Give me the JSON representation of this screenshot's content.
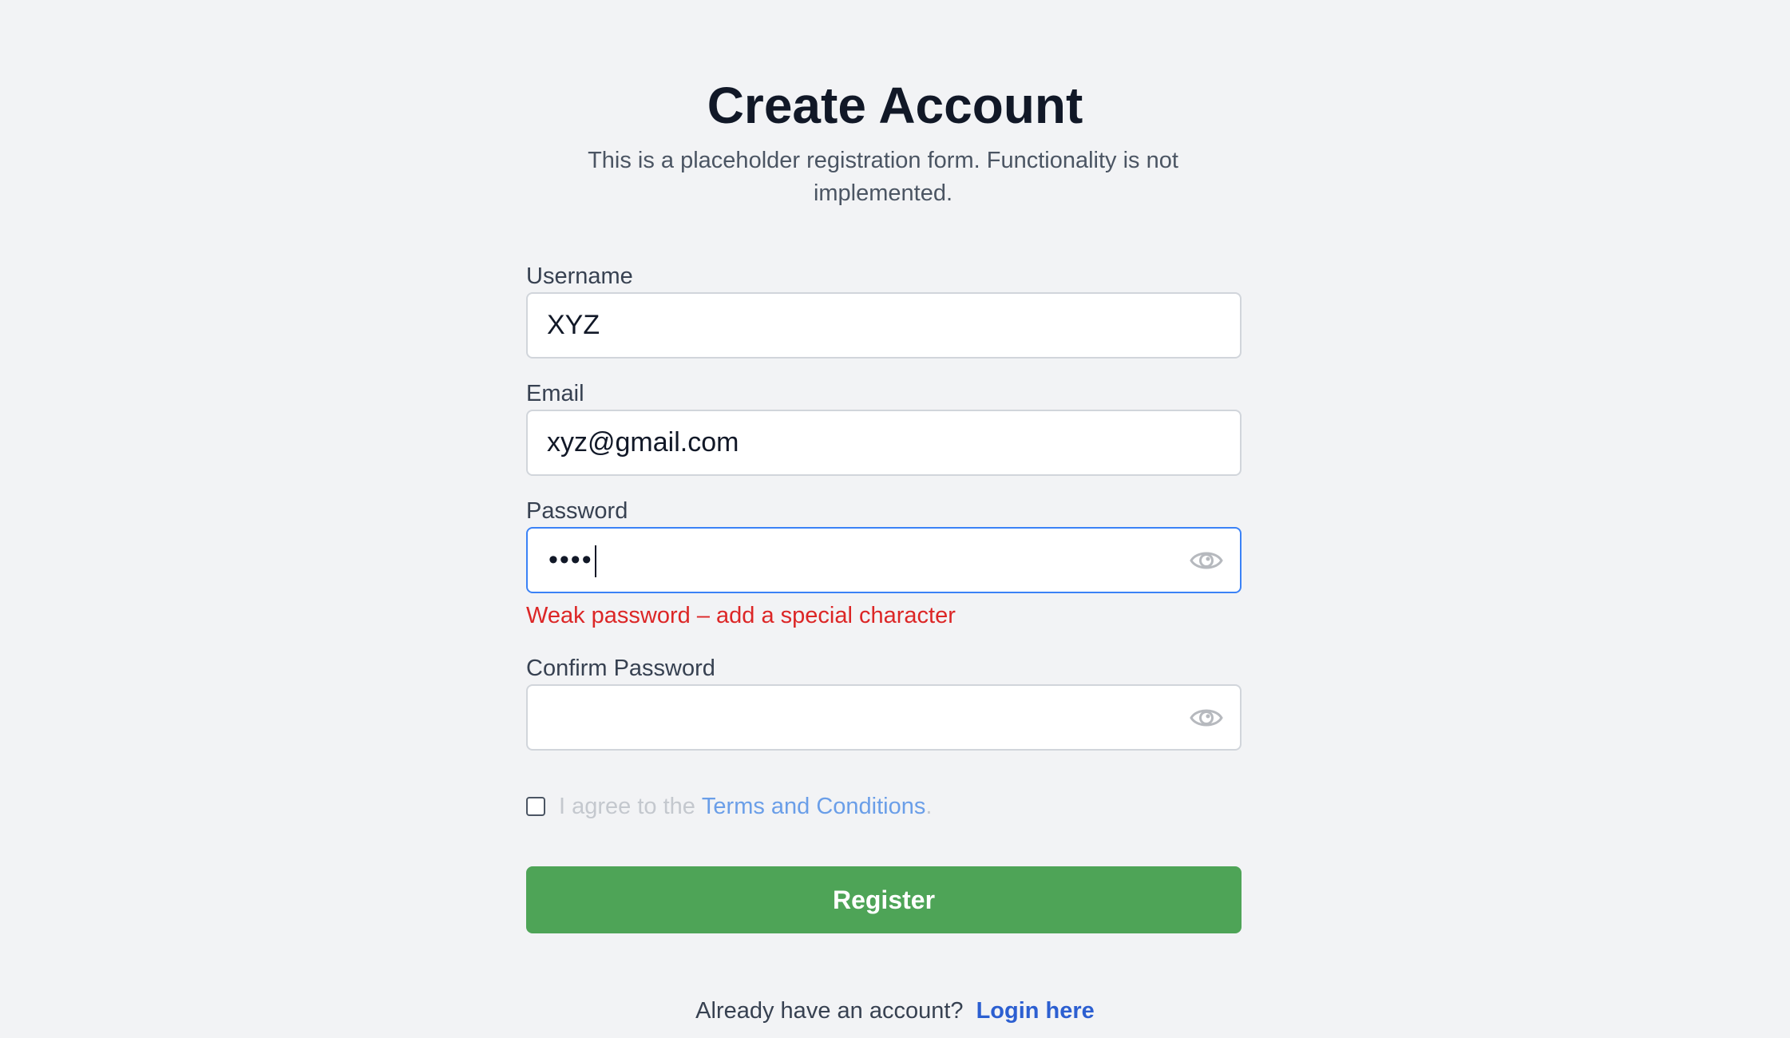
{
  "header": {
    "title": "Create Account",
    "subtitle": "This is a placeholder registration form. Functionality is not implemented."
  },
  "form": {
    "username": {
      "label": "Username",
      "value": "XYZ"
    },
    "email": {
      "label": "Email",
      "value": "xyz@gmail.com"
    },
    "password": {
      "label": "Password",
      "masked_value": "••••",
      "toggle_icon": "eye-icon"
    },
    "password_error": "Weak password – add a special character",
    "confirm_password": {
      "label": "Confirm Password",
      "value": "",
      "toggle_icon": "eye-icon"
    },
    "agree": {
      "prefix": "I agree to the",
      "link": "Terms and Conditions",
      "suffix": ".",
      "checked": false
    },
    "register_label": "Register"
  },
  "footer": {
    "prompt": "Already have an account?",
    "login_link": "Login here"
  },
  "colors": {
    "background": "#f2f3f5",
    "primary_button": "#4ea457",
    "error": "#dc2626",
    "link": "#2c5fd1",
    "focus_border": "#3b82f6"
  }
}
